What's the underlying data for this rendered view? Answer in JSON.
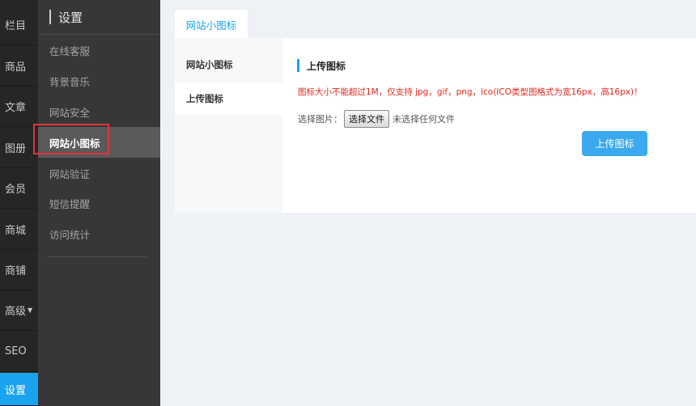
{
  "rail": {
    "items": [
      {
        "label": "栏目"
      },
      {
        "label": "商品"
      },
      {
        "label": "文章"
      },
      {
        "label": "图册"
      },
      {
        "label": "会员"
      },
      {
        "label": "商城"
      },
      {
        "label": "商铺"
      },
      {
        "label": "高级",
        "caret": "▼"
      },
      {
        "label": "SEO"
      },
      {
        "label": "设置"
      }
    ]
  },
  "subnav": {
    "title": "设置",
    "items": [
      {
        "label": "在线客服"
      },
      {
        "label": "背景音乐"
      },
      {
        "label": "网站安全"
      },
      {
        "label": "网站小图标"
      },
      {
        "label": "网站验证"
      },
      {
        "label": "短信提醒"
      },
      {
        "label": "访问统计"
      }
    ]
  },
  "main": {
    "tab_label": "网站小图标",
    "left_menu": [
      {
        "label": "网站小图标"
      },
      {
        "label": "上传图标"
      }
    ],
    "section_title": "上传图标",
    "warning": "图标大小不能超过1M，仅支持 jpg，gif，png，ico(ICO类型图格式为宽16px，高16px)！",
    "file_label": "选择图片：",
    "file_button": "选择文件",
    "file_status": "未选择任何文件",
    "upload_button": "上传图标"
  },
  "colors": {
    "accent": "#1aa3ee",
    "warning": "#e0261d",
    "highlight_border": "#e0343a"
  }
}
